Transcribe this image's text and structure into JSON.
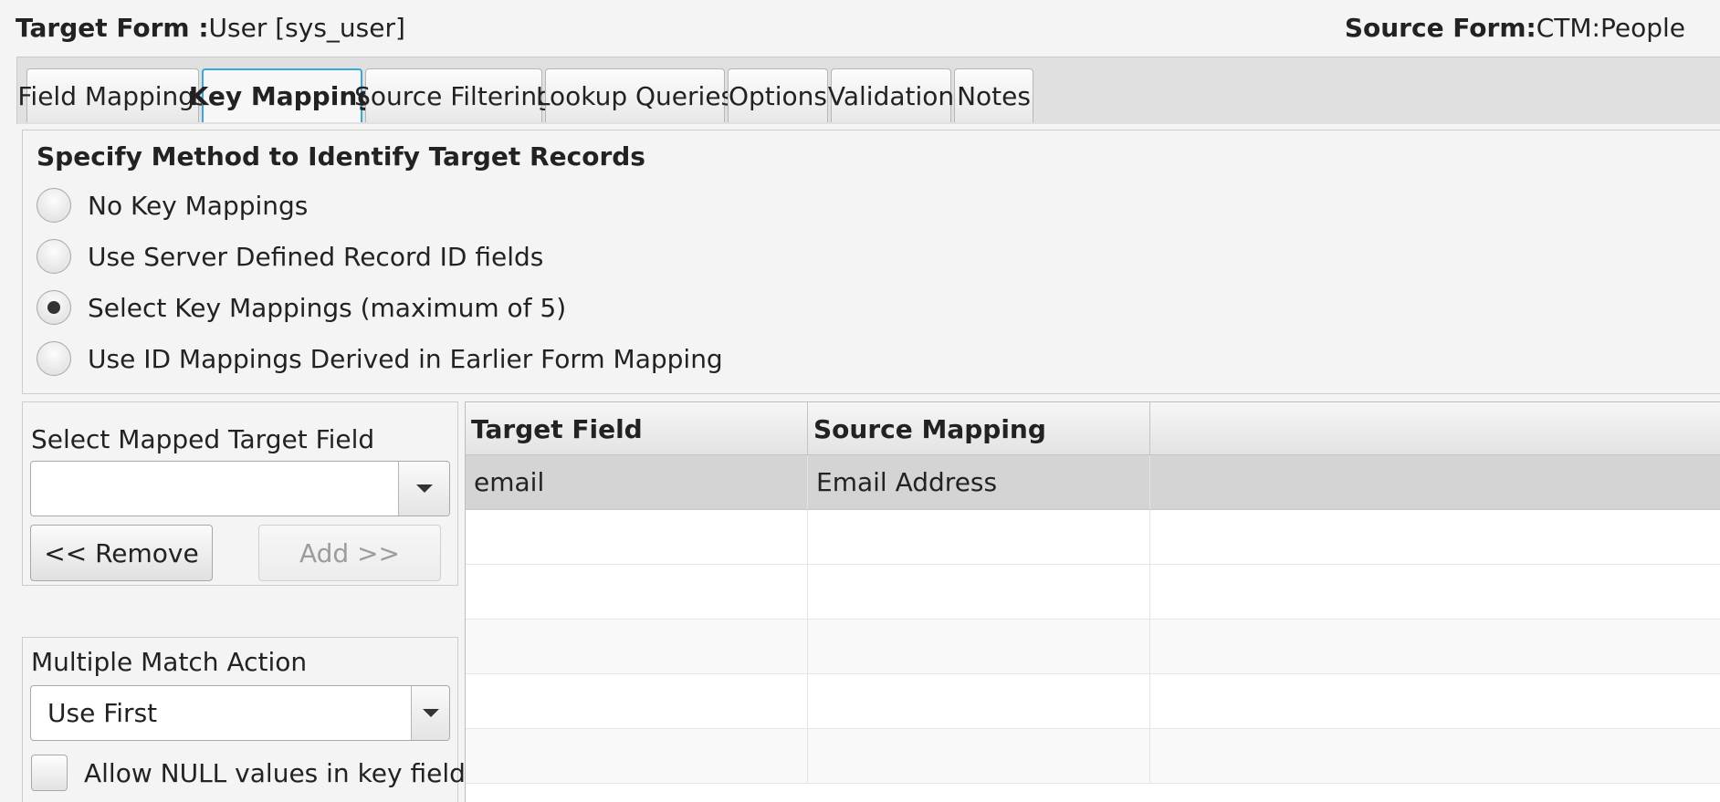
{
  "header": {
    "target_label": "Target Form :",
    "target_value": "User [sys_user]",
    "source_label": "Source Form:",
    "source_value": "CTM:People"
  },
  "tabs": [
    {
      "label": "Field Mappings",
      "active": false
    },
    {
      "label": "Key Mapping",
      "active": true
    },
    {
      "label": "Source Filtering",
      "active": false
    },
    {
      "label": "Lookup Queries",
      "active": false
    },
    {
      "label": "Options",
      "active": false
    },
    {
      "label": "Validation",
      "active": false
    },
    {
      "label": "Notes",
      "active": false
    }
  ],
  "method": {
    "title": "Specify Method to Identify Target Records",
    "options": [
      {
        "label": "No Key Mappings",
        "selected": false
      },
      {
        "label": "Use Server Defined Record ID fields",
        "selected": false
      },
      {
        "label": "Select Key Mappings (maximum of 5)",
        "selected": true
      },
      {
        "label": "Use ID Mappings Derived in Earlier Form Mapping",
        "selected": false
      }
    ]
  },
  "left_panel": {
    "select_field_label": "Select Mapped Target Field",
    "select_field_value": "",
    "remove_button": "<< Remove",
    "add_button": "Add >>",
    "add_button_disabled": true,
    "multiple_match_label": "Multiple Match Action",
    "multiple_match_value": "Use First",
    "allow_null_label": "Allow NULL values in key fields",
    "allow_null_checked": false
  },
  "table": {
    "columns": [
      "Target Field",
      "Source Mapping",
      ""
    ],
    "rows": [
      {
        "target": "email",
        "source": "Email Address",
        "selected": true
      }
    ],
    "empty_rows": 5
  }
}
